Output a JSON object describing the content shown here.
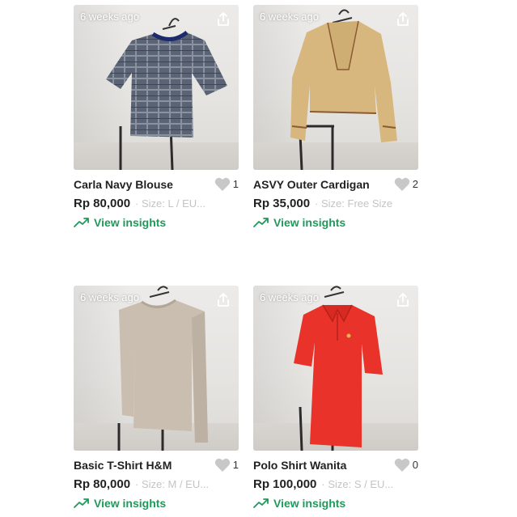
{
  "products": [
    {
      "time": "6 weeks ago",
      "title": "Carla Navy Blouse",
      "likes": "1",
      "price": "Rp 80,000",
      "size": "· Size: L / EU...",
      "insights": "View insights"
    },
    {
      "time": "6 weeks ago",
      "title": "ASVY Outer Cardigan",
      "likes": "2",
      "price": "Rp 35,000",
      "size": "· Size: Free Size",
      "insights": "View insights"
    },
    {
      "time": "6 weeks ago",
      "title": "Basic T-Shirt H&M",
      "likes": "1",
      "price": "Rp 80,000",
      "size": "· Size: M / EU...",
      "insights": "View insights"
    },
    {
      "time": "6 weeks ago",
      "title": "Polo Shirt Wanita",
      "likes": "0",
      "price": "Rp 100,000",
      "size": "· Size: S / EU...",
      "insights": "View insights"
    }
  ],
  "icons": {
    "share": "share-icon",
    "like": "heart-icon",
    "insights": "trending-up-icon"
  },
  "colors": {
    "accent_green": "#1f9a5a",
    "muted_text": "#c4c4c4",
    "heart_gray": "#c8c8c8"
  }
}
